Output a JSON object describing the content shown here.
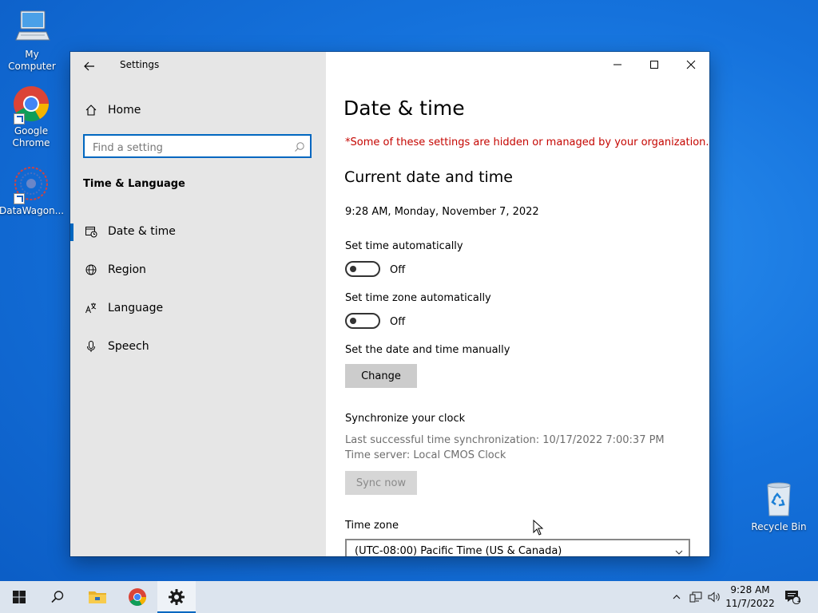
{
  "desktop": {
    "icons": [
      {
        "label": "My Computer"
      },
      {
        "label": "Google Chrome"
      },
      {
        "label": "DataWagon..."
      },
      {
        "label": "Recycle Bin"
      }
    ]
  },
  "window": {
    "app_title": "Settings",
    "nav": {
      "home_label": "Home",
      "search_placeholder": "Find a setting",
      "section_title": "Time & Language",
      "items": [
        {
          "label": "Date & time",
          "icon": "calendar-clock-icon",
          "active": true
        },
        {
          "label": "Region",
          "icon": "globe-icon"
        },
        {
          "label": "Language",
          "icon": "language-icon"
        },
        {
          "label": "Speech",
          "icon": "microphone-icon"
        }
      ]
    },
    "content": {
      "title": "Date & time",
      "managed_notice": "*Some of these settings are hidden or managed by your organization.",
      "current_heading": "Current date and time",
      "current_datetime": "9:28 AM, Monday, November 7, 2022",
      "set_time_auto_label": "Set time automatically",
      "set_time_auto_state": "Off",
      "set_tz_auto_label": "Set time zone automatically",
      "set_tz_auto_state": "Off",
      "manual_label": "Set the date and time manually",
      "change_button": "Change",
      "sync_heading": "Synchronize your clock",
      "last_sync": "Last successful time synchronization: 10/17/2022 7:00:37 PM",
      "time_server": "Time server: Local CMOS Clock",
      "sync_button": "Sync now",
      "timezone_label": "Time zone",
      "timezone_value": "(UTC-08:00) Pacific Time (US & Canada)"
    }
  },
  "taskbar": {
    "time": "9:28 AM",
    "date": "11/7/2022",
    "notification_count": "1"
  },
  "colors": {
    "accent": "#0067c0",
    "warning": "#c50500",
    "nav_bg": "#e6e6e6",
    "taskbar_bg": "#dce4ee"
  }
}
